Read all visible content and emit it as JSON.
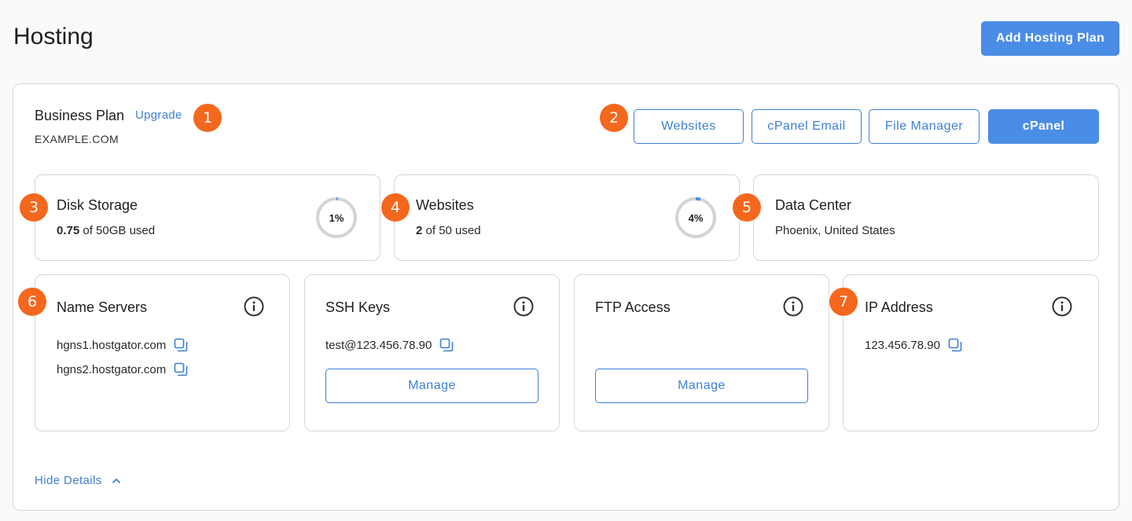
{
  "page": {
    "title": "Hosting",
    "add_plan_label": "Add Hosting Plan"
  },
  "plan": {
    "name": "Business Plan",
    "upgrade_label": "Upgrade",
    "domain": "EXAMPLE.COM"
  },
  "actions": {
    "websites": "Websites",
    "cpanel_email": "cPanel Email",
    "file_manager": "File Manager",
    "cpanel": "cPanel"
  },
  "badges": [
    "1",
    "2",
    "3",
    "4",
    "5",
    "6",
    "7"
  ],
  "disk": {
    "title": "Disk Storage",
    "used": "0.75",
    "rest": " of 50GB used",
    "percent_label": "1%",
    "percent": 1
  },
  "websites": {
    "title": "Websites",
    "used": "2",
    "rest": " of 50 used",
    "percent_label": "4%",
    "percent": 4
  },
  "datacenter": {
    "title": "Data Center",
    "location": "Phoenix, United States"
  },
  "nameservers": {
    "title": "Name Servers",
    "items": [
      "hgns1.hostgator.com",
      "hgns2.hostgator.com"
    ]
  },
  "ssh": {
    "title": "SSH Keys",
    "key": "test@123.456.78.90",
    "manage_label": "Manage"
  },
  "ftp": {
    "title": "FTP Access",
    "manage_label": "Manage"
  },
  "ip": {
    "title": "IP Address",
    "value": "123.456.78.90"
  },
  "footer": {
    "hide_details_label": "Hide Details"
  },
  "colors": {
    "accent": "#4a8de6",
    "link": "#3d7fd8",
    "badge": "#f5671d",
    "border": "#d6d6d6",
    "ring_track": "#d4d4d4"
  },
  "icons": {
    "info": "info-circle-icon",
    "copy": "copy-icon",
    "chevron": "chevron-up-icon"
  }
}
